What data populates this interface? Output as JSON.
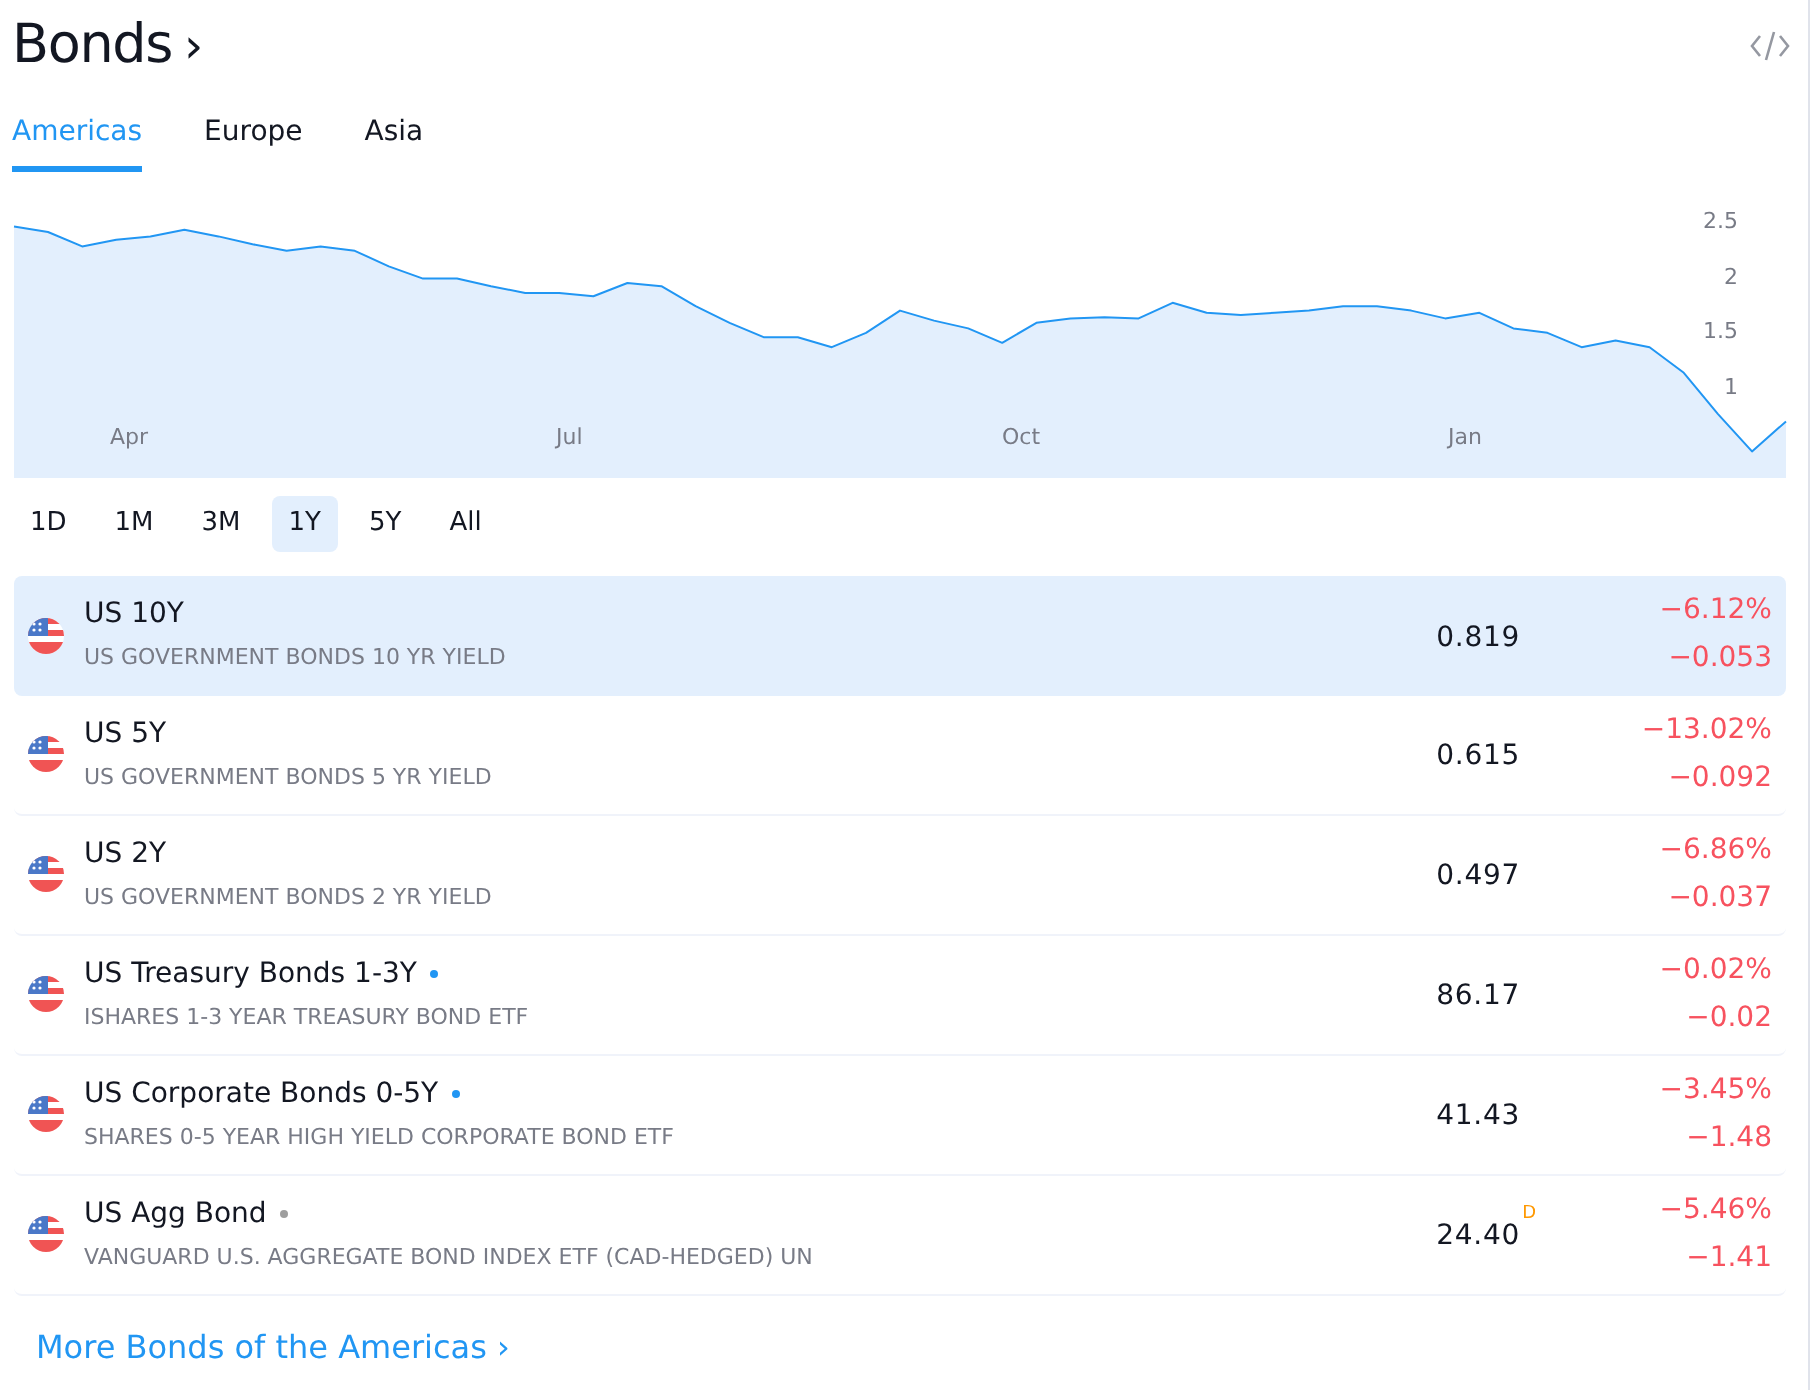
{
  "header": {
    "title": "Bonds",
    "chevron": "›"
  },
  "tabs": [
    {
      "label": "Americas",
      "selected": true
    },
    {
      "label": "Europe",
      "selected": false
    },
    {
      "label": "Asia",
      "selected": false
    }
  ],
  "chart": {
    "month_labels": [
      "Apr",
      "Jul",
      "Oct",
      "Jan"
    ],
    "chart_data": {
      "type": "area",
      "ylim": [
        0.2,
        2.6
      ],
      "yticks": [
        1,
        1.5,
        2,
        2.5
      ],
      "series": [
        {
          "color": "#2196f3",
          "values": [
            2.47,
            2.42,
            2.29,
            2.35,
            2.38,
            2.44,
            2.38,
            2.31,
            2.25,
            2.29,
            2.25,
            2.11,
            2.0,
            2.0,
            1.93,
            1.87,
            1.87,
            1.84,
            1.96,
            1.93,
            1.75,
            1.6,
            1.47,
            1.47,
            1.38,
            1.51,
            1.71,
            1.62,
            1.55,
            1.42,
            1.6,
            1.64,
            1.65,
            1.64,
            1.78,
            1.69,
            1.67,
            1.69,
            1.71,
            1.75,
            1.75,
            1.71,
            1.64,
            1.69,
            1.55,
            1.51,
            1.38,
            1.44,
            1.38,
            1.15,
            0.78,
            0.44,
            0.71
          ]
        }
      ]
    }
  },
  "ranges": [
    {
      "label": "1D",
      "selected": false
    },
    {
      "label": "1M",
      "selected": false
    },
    {
      "label": "3M",
      "selected": false
    },
    {
      "label": "1Y",
      "selected": true
    },
    {
      "label": "5Y",
      "selected": false
    },
    {
      "label": "All",
      "selected": false
    }
  ],
  "rows": [
    {
      "name": "US 10Y",
      "description": "US GOVERNMENT BONDS 10 YR YIELD",
      "price": "0.819",
      "change_percent": "−6.12%",
      "change": "−0.053",
      "selected": true
    },
    {
      "name": "US 5Y",
      "description": "US GOVERNMENT BONDS 5 YR YIELD",
      "price": "0.615",
      "change_percent": "−13.02%",
      "change": "−0.092",
      "selected": false
    },
    {
      "name": "US 2Y",
      "description": "US GOVERNMENT BONDS 2 YR YIELD",
      "price": "0.497",
      "change_percent": "−6.86%",
      "change": "−0.037",
      "selected": false
    },
    {
      "name": "US Treasury Bonds 1-3Y",
      "color": "#2196f3",
      "description": "ISHARES 1-3 YEAR TREASURY BOND ETF",
      "price": "86.17",
      "change_percent": "−0.02%",
      "change": "−0.02",
      "selected": false
    },
    {
      "name": "US Corporate Bonds 0-5Y",
      "color": "#2196f3",
      "description": "SHARES 0-5 YEAR HIGH YIELD CORPORATE BOND ETF",
      "price": "41.43",
      "change_percent": "−3.45%",
      "change": "−1.48",
      "selected": false
    },
    {
      "name": "US Agg Bond",
      "color": "#9e9e9e",
      "description": "VANGUARD U.S. AGGREGATE BOND INDEX ETF (CAD-HEDGED) UN",
      "price": "24.40",
      "price_badge": "D",
      "change_percent": "−5.46%",
      "change": "−1.41",
      "selected": false
    }
  ],
  "more_link": {
    "label": "More Bonds of the Americas",
    "chevron": "›"
  }
}
